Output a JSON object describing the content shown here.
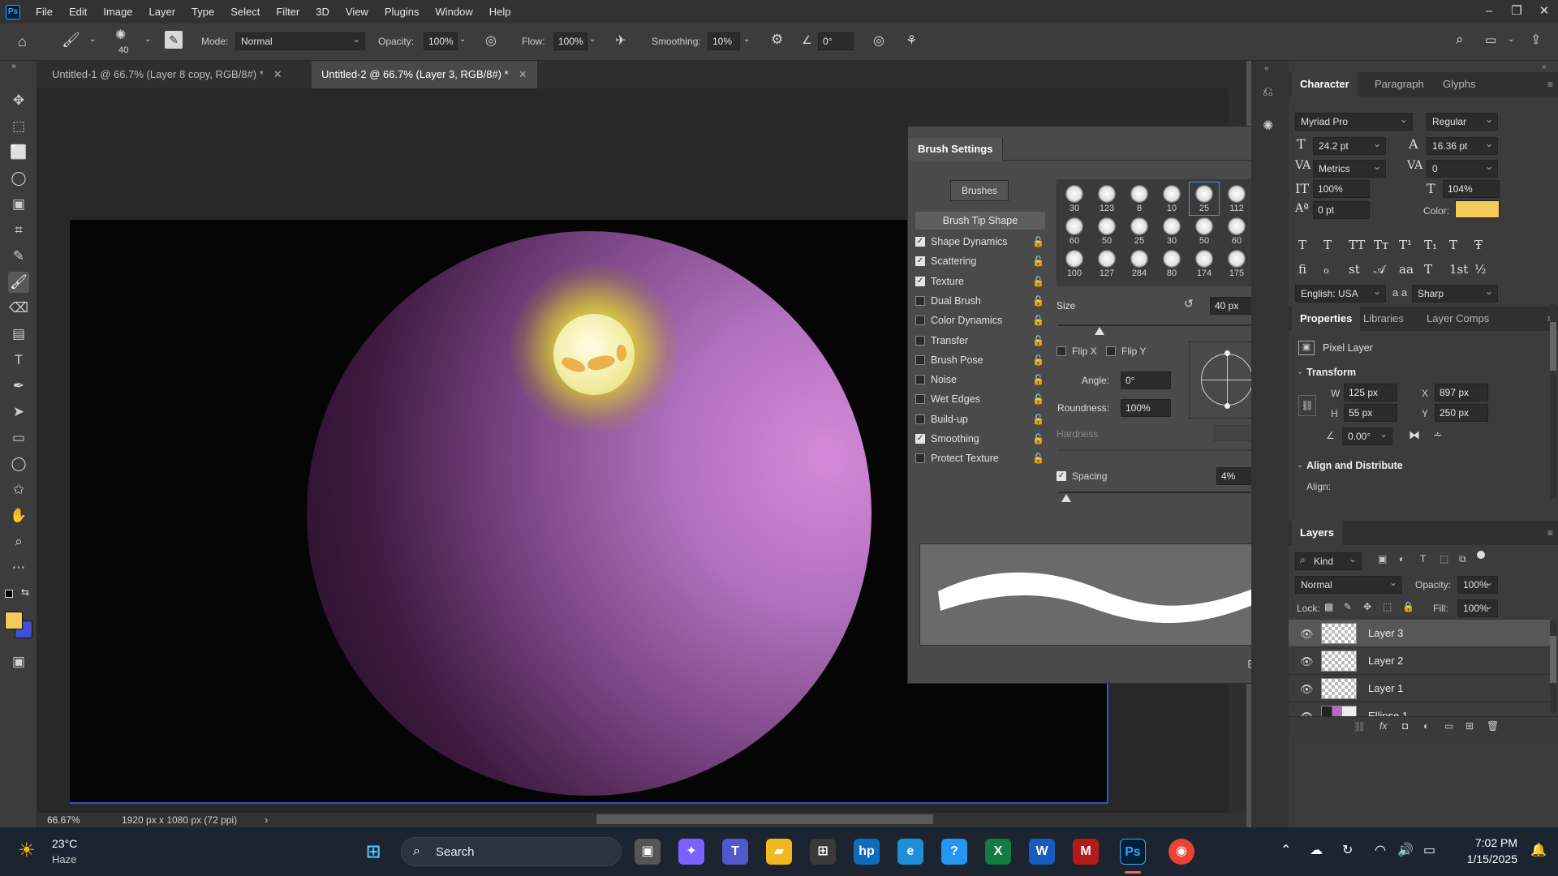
{
  "app": {
    "logo_text": "Ps"
  },
  "menubar": {
    "items": [
      "File",
      "Edit",
      "Image",
      "Layer",
      "Type",
      "Select",
      "Filter",
      "3D",
      "View",
      "Plugins",
      "Window",
      "Help"
    ]
  },
  "window_controls": {
    "minimize": "–",
    "restore": "❐",
    "close": "✕"
  },
  "options_bar": {
    "brush_size": "40",
    "mode_label": "Mode:",
    "mode_value": "Normal",
    "opacity_label": "Opacity:",
    "opacity_value": "100%",
    "flow_label": "Flow:",
    "flow_value": "100%",
    "smoothing_label": "Smoothing:",
    "smoothing_value": "10%",
    "angle_value": "0°"
  },
  "tabs": [
    {
      "label": "Untitled-1 @ 66.7% (Layer 8 copy, RGB/8#) *",
      "close": "✕"
    },
    {
      "label": "Untitled-2 @ 66.7% (Layer 3, RGB/8#) *",
      "close": "✕"
    }
  ],
  "status": {
    "zoom": "66.67%",
    "doc_info": "1920 px x 1080 px (72 ppi)",
    "arrow": "›"
  },
  "brush_settings": {
    "title": "Brush Settings",
    "brushes_button": "Brushes",
    "tip_shape": "Brush Tip Shape",
    "options": [
      {
        "label": "Shape Dynamics",
        "checked": true
      },
      {
        "label": "Scattering",
        "checked": true
      },
      {
        "label": "Texture",
        "checked": true
      },
      {
        "label": "Dual Brush",
        "checked": false
      },
      {
        "label": "Color Dynamics",
        "checked": false
      },
      {
        "label": "Transfer",
        "checked": false
      },
      {
        "label": "Brush Pose",
        "checked": false
      },
      {
        "label": "Noise",
        "checked": false
      },
      {
        "label": "Wet Edges",
        "checked": false
      },
      {
        "label": "Build-up",
        "checked": false
      },
      {
        "label": "Smoothing",
        "checked": true
      },
      {
        "label": "Protect Texture",
        "checked": false
      }
    ],
    "tip_sizes": [
      "30",
      "123",
      "8",
      "10",
      "25",
      "112",
      "60",
      "50",
      "25",
      "30",
      "50",
      "60",
      "100",
      "127",
      "284",
      "80",
      "174",
      "175"
    ],
    "size_label": "Size",
    "size_value": "40 px",
    "size_fraction": 0.2,
    "flip_x": "Flip X",
    "flip_y": "Flip Y",
    "angle_label": "Angle:",
    "angle_value": "0°",
    "roundness_label": "Roundness:",
    "roundness_value": "100%",
    "hardness_label": "Hardness",
    "spacing_label": "Spacing",
    "spacing_value": "4%",
    "spacing_fraction": 0.04
  },
  "character": {
    "tabs": [
      "Character",
      "Paragraph",
      "Glyphs"
    ],
    "font_family": "Myriad Pro",
    "font_style": "Regular",
    "font_size": "24.2 pt",
    "leading": "16.36 pt",
    "kerning": "Metrics",
    "tracking": "0",
    "vscale": "100%",
    "hscale": "104%",
    "baseline": "0 pt",
    "color_label": "Color:",
    "color": "#f5c95a",
    "language": "English: USA",
    "aa_label": "a a",
    "antialias": "Sharp",
    "style_glyphs1": [
      "T",
      "T",
      "TT",
      "Tт",
      "T¹",
      "T₁",
      "T",
      "Ŧ"
    ],
    "style_glyphs2": [
      "fi",
      "ℴ",
      "st",
      "𝒜",
      "aa",
      "T",
      "1st",
      "½"
    ]
  },
  "properties": {
    "tabs": [
      "Properties",
      "Libraries",
      "Layer Comps"
    ],
    "kind": "Pixel Layer",
    "transform_label": "Transform",
    "w_label": "W",
    "w": "125 px",
    "x_label": "X",
    "x": "897 px",
    "h_label": "H",
    "h": "55 px",
    "y_label": "Y",
    "y": "250 px",
    "angle": "0.00°",
    "align_label": "Align and Distribute",
    "align_sub": "Align:"
  },
  "layers": {
    "tab": "Layers",
    "kind": "Kind",
    "blend": "Normal",
    "opacity_label": "Opacity:",
    "opacity": "100%",
    "lock_label": "Lock:",
    "fill_label": "Fill:",
    "fill": "100%",
    "items": [
      "Layer 3",
      "Layer 2",
      "Layer 1",
      "Ellipse 1"
    ]
  },
  "taskbar": {
    "weather_temp": "23°C",
    "weather_desc": "Haze",
    "search": "Search",
    "time": "7:02 PM",
    "date": "1/15/2025"
  },
  "colors": {
    "foreground": "#f5c95a",
    "background": "#3f4fd6"
  }
}
